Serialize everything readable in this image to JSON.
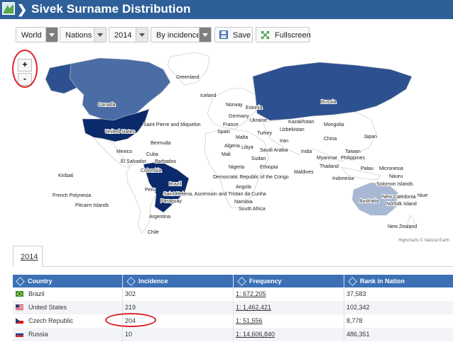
{
  "header": {
    "title": "Sivek Surname Distribution",
    "chevron": "❯",
    "logo_icon": "map-logo-icon"
  },
  "toolbar": {
    "region": "World",
    "level": "Nations",
    "year": "2014",
    "metric": "By incidence",
    "save_label": "Save",
    "fullscreen_label": "Fullscreen"
  },
  "zoom": {
    "in": "+",
    "out": "-"
  },
  "map": {
    "credit": "Highcharts © Natural Earth",
    "labels": {
      "greenland": "Greenland",
      "iceland": "Iceland",
      "canada": "Canada",
      "usa": "United States",
      "spm": "Saint Pierre and Miquelon",
      "bermuda": "Bermuda",
      "mexico": "Mexico",
      "cuba": "Cuba",
      "elsalvador": "El Salvador",
      "barbados": "Barbados",
      "colombia": "Colombia",
      "kiribati": "Kiribati",
      "frenchpoly": "French Polynesia",
      "pitcairn": "Pitcairn Islands",
      "peru": "Peru",
      "brazil": "Brazil",
      "sthelena": "Saint Helena, Ascension and Tristan da Cunha",
      "paraguay": "Paraguay",
      "argentina": "Argentina",
      "chile": "Chile",
      "norway": "Norway",
      "estonia": "Estonia",
      "germany": "Germany",
      "ukraine": "Ukraine",
      "france": "France",
      "spain": "Spain",
      "malta": "Malta",
      "turkey": "Turkey",
      "algeria": "Algeria",
      "libya": "Libya",
      "mali": "Mali",
      "saudi": "Saudi Arabia",
      "sudan": "Sudan",
      "nigeria": "Nigeria",
      "ethiopia": "Ethiopia",
      "drc": "Democratic Republic of the Congo",
      "angola": "Angola",
      "namibia": "Namibia",
      "southafrica": "South Africa",
      "russia": "Russia",
      "kazakhstan": "Kazakhstan",
      "uzbekistan": "Uzbekistan",
      "mongolia": "Mongolia",
      "iran": "Iran",
      "china": "China",
      "japan": "Japan",
      "india": "India",
      "taiwan": "Taiwan",
      "myanmar": "Myanmar",
      "philippines": "Philippines",
      "thailand": "Thailand",
      "maldives": "Maldives",
      "palau": "Palau",
      "micronesia": "Micronesia",
      "nauru": "Nauru",
      "indonesia": "Indonesia",
      "solomon": "Solomon Islands",
      "australia": "Australia",
      "newcaledonia": "New Caledonia",
      "niue": "Niue",
      "norfolk": "Norfolk Island",
      "newzealand": "New Zealand"
    },
    "colors": {
      "highest": "#0a2a6b",
      "high": "#2d5190",
      "mid": "#4b6da6",
      "low": "#a7b8d4",
      "land": "#ffffff",
      "border": "#c0c0c0"
    }
  },
  "tabs": {
    "active": "2014"
  },
  "table": {
    "headers": [
      "Country",
      "Incidence",
      "Frequency",
      "Rank in Nation"
    ],
    "rows": [
      {
        "country": "Brazil",
        "incidence": "302",
        "frequency": "1: 672,205",
        "rank": "37,583"
      },
      {
        "country": "United States",
        "incidence": "219",
        "frequency": "1: 1,462,421",
        "rank": "102,342"
      },
      {
        "country": "Czech Republic",
        "incidence": "204",
        "frequency": "1: 51,556",
        "rank": "8,778"
      },
      {
        "country": "Russia",
        "incidence": "10",
        "frequency": "1: 14,606,840",
        "rank": "486,351"
      }
    ]
  },
  "annotation_color": "#d9232b"
}
